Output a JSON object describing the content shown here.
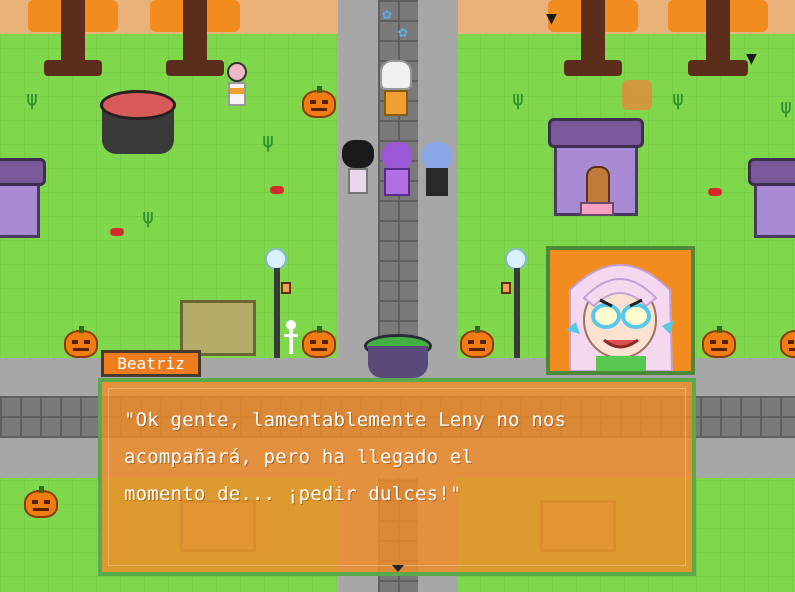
{
  "dialog": {
    "speaker": "Beatriz",
    "text": "\"Ok gente, lamentablemente Leny no nos\nacompañará, pero ha llegado el\nmomento de... ¡pedir dulces!\"",
    "advance_icon": "triangle-down-icon"
  },
  "portrait": {
    "character": "Beatriz",
    "description_icon": "character-portrait-icon"
  },
  "colors": {
    "grass": "#7fd84c",
    "dialog_bg": "#f18c28",
    "dialog_border": "#5aa94a",
    "name_tag": "#f07c20",
    "road": "#8e8e8e"
  }
}
